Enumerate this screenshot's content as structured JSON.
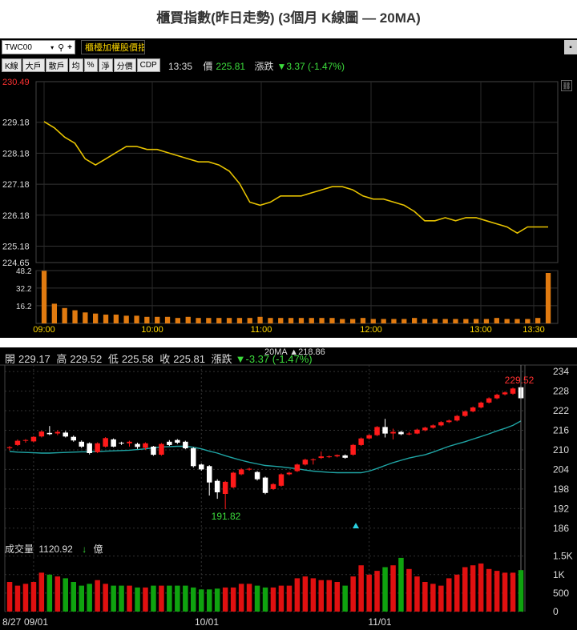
{
  "page_title": "櫃買指數(昨日走勢) (3個月 K線圖 — 20MA)",
  "intraday": {
    "code": "TWC00",
    "name": "櫃檯加權股價指",
    "buttons": [
      "K線",
      "大戶",
      "散戶",
      "均",
      "%",
      "淨",
      "分價",
      "CDP"
    ],
    "time": "13:35",
    "price_label": "價",
    "price": "225.81",
    "change_label": "漲跌",
    "change": "▼3.37 (-1.47%)"
  },
  "kline": {
    "open_label": "開",
    "open": "229.17",
    "high_label": "高",
    "high": "229.52",
    "low_label": "低",
    "low": "225.58",
    "close_label": "收",
    "close": "225.81",
    "change_label": "漲跌",
    "change": "▼-3.37 (-1.47%)",
    "ma_label": "20MA",
    "ma_value": "▲218.86",
    "volume_label": "成交量",
    "volume": "1120.92",
    "volume_arrow": "↓",
    "volume_unit": "億",
    "high_marker": "229.52",
    "low_marker": "191.82"
  },
  "chart_data": [
    {
      "type": "line",
      "name": "intraday",
      "x_ticks": [
        "09:00",
        "10:00",
        "11:00",
        "12:00",
        "13:00",
        "13:30"
      ],
      "y_ticks": [
        "230.49",
        "229.18",
        "228.18",
        "227.18",
        "226.18",
        "225.18",
        "224.65"
      ],
      "ylim": [
        224.65,
        230.49
      ],
      "color": "#e6c200",
      "values": [
        229.2,
        229.0,
        228.7,
        228.5,
        228.0,
        227.8,
        228.0,
        228.2,
        228.4,
        228.4,
        228.3,
        228.3,
        228.2,
        228.1,
        228.0,
        227.9,
        227.9,
        227.8,
        227.6,
        227.2,
        226.6,
        226.5,
        226.6,
        226.8,
        226.8,
        226.8,
        226.9,
        227.0,
        227.1,
        227.1,
        227.0,
        226.8,
        226.7,
        226.7,
        226.6,
        226.5,
        226.3,
        226.0,
        226.0,
        226.1,
        226.0,
        226.1,
        226.1,
        226.0,
        225.9,
        225.8,
        225.6,
        225.8,
        225.8,
        225.8
      ],
      "volume_ticks": [
        "48.2",
        "32.2",
        "16.2"
      ],
      "volume_max": 48.2,
      "volume": [
        48,
        18,
        14,
        12,
        10,
        9,
        8,
        8,
        7,
        7,
        6,
        6,
        6,
        5,
        6,
        5,
        5,
        5,
        5,
        5,
        5,
        6,
        5,
        5,
        5,
        5,
        5,
        5,
        5,
        4,
        4,
        5,
        4,
        4,
        4,
        4,
        5,
        4,
        4,
        4,
        4,
        4,
        4,
        4,
        5,
        4,
        4,
        4,
        5,
        46
      ]
    },
    {
      "type": "candlestick",
      "name": "3-month K line with 20MA",
      "x_ticks": [
        "8/27",
        "09/01",
        "10/01",
        "11/01"
      ],
      "y_ticks": [
        "234",
        "228",
        "222",
        "216",
        "210",
        "204",
        "198",
        "192",
        "186"
      ],
      "ylim": [
        183,
        236
      ],
      "candles": [
        [
          210.5,
          210.8,
          209.8,
          211.2
        ],
        [
          211.5,
          212.8,
          211.2,
          213.2
        ],
        [
          212.8,
          213.0,
          212.2,
          213.3
        ],
        [
          212.6,
          214.0,
          212.3,
          214.2
        ],
        [
          214.1,
          215.6,
          213.8,
          215.9
        ],
        [
          215.2,
          214.8,
          214.5,
          217.3
        ],
        [
          215.0,
          215.5,
          214.5,
          216.0
        ],
        [
          215.3,
          214.1,
          213.8,
          215.8
        ],
        [
          214.0,
          212.9,
          212.5,
          214.4
        ],
        [
          212.5,
          211.0,
          210.6,
          212.9
        ],
        [
          212.0,
          209.0,
          208.6,
          212.3
        ],
        [
          209.3,
          212.0,
          209.0,
          212.3
        ],
        [
          211.0,
          213.6,
          210.7,
          213.9
        ],
        [
          213.2,
          211.0,
          210.8,
          213.5
        ],
        [
          212.2,
          212.0,
          211.5,
          212.5
        ],
        [
          212.0,
          212.5,
          211.0,
          212.8
        ],
        [
          211.8,
          210.9,
          210.3,
          212.2
        ],
        [
          210.6,
          212.0,
          210.0,
          212.3
        ],
        [
          211.0,
          208.5,
          208.2,
          211.2
        ],
        [
          208.5,
          211.8,
          208.2,
          212.1
        ],
        [
          212.5,
          211.5,
          211.2,
          213.0
        ],
        [
          213.0,
          212.2,
          211.8,
          213.3
        ],
        [
          212.5,
          210.5,
          210.2,
          212.8
        ],
        [
          210.5,
          205.0,
          204.6,
          210.8
        ],
        [
          205.5,
          204.0,
          203.6,
          205.8
        ],
        [
          205.0,
          200.0,
          196.0,
          205.3
        ],
        [
          200.5,
          197.0,
          195.0,
          201.0
        ],
        [
          196.5,
          200.2,
          191.8,
          200.5
        ],
        [
          198.5,
          203.0,
          198.2,
          203.3
        ],
        [
          202.5,
          204.0,
          202.2,
          204.4
        ],
        [
          204.0,
          204.2,
          203.6,
          204.5
        ],
        [
          203.2,
          201.0,
          200.6,
          203.5
        ],
        [
          201.5,
          196.8,
          196.4,
          201.8
        ],
        [
          198.0,
          199.5,
          197.7,
          199.8
        ],
        [
          199.0,
          202.5,
          198.7,
          202.8
        ],
        [
          202.5,
          203.0,
          202.2,
          203.3
        ],
        [
          203.5,
          205.5,
          203.2,
          205.8
        ],
        [
          205.5,
          207.0,
          205.2,
          207.3
        ],
        [
          207.0,
          207.1,
          205.5,
          207.4
        ],
        [
          207.5,
          208.0,
          207.2,
          209.5
        ],
        [
          208.0,
          208.0,
          207.5,
          208.3
        ],
        [
          208.0,
          208.4,
          207.7,
          208.6
        ],
        [
          208.3,
          207.6,
          207.3,
          208.6
        ],
        [
          208.5,
          211.5,
          208.2,
          211.8
        ],
        [
          211.5,
          213.5,
          211.2,
          213.8
        ],
        [
          213.5,
          214.5,
          213.2,
          214.8
        ],
        [
          214.5,
          217.0,
          214.2,
          217.3
        ],
        [
          217.0,
          215.0,
          213.8,
          219.5
        ],
        [
          215.0,
          215.5,
          213.2,
          216.5
        ],
        [
          215.5,
          214.8,
          214.5,
          215.8
        ],
        [
          215.0,
          215.0,
          214.5,
          215.5
        ],
        [
          215.0,
          216.2,
          214.8,
          216.5
        ],
        [
          216.0,
          216.8,
          215.7,
          217.1
        ],
        [
          216.8,
          217.5,
          216.5,
          217.8
        ],
        [
          217.5,
          218.5,
          217.2,
          218.8
        ],
        [
          218.5,
          219.0,
          218.2,
          219.3
        ],
        [
          219.0,
          220.4,
          218.7,
          220.7
        ],
        [
          220.4,
          221.8,
          220.1,
          222.1
        ],
        [
          221.8,
          223.0,
          221.5,
          223.3
        ],
        [
          223.0,
          224.5,
          222.7,
          224.8
        ],
        [
          224.5,
          225.8,
          224.2,
          226.1
        ],
        [
          225.8,
          226.9,
          225.5,
          227.2
        ],
        [
          227.0,
          227.6,
          226.7,
          227.9
        ],
        [
          227.2,
          228.8,
          226.9,
          229.1
        ],
        [
          229.17,
          225.81,
          225.58,
          229.52
        ]
      ],
      "ma20": [
        209.5,
        209.3,
        209.2,
        209.1,
        209.0,
        209.0,
        209.1,
        209.2,
        209.3,
        209.4,
        209.4,
        209.5,
        209.6,
        209.7,
        209.8,
        209.9,
        210.1,
        210.3,
        210.6,
        210.9,
        211.0,
        211.1,
        211.1,
        210.8,
        210.3,
        209.6,
        209.0,
        208.2,
        207.5,
        206.8,
        206.2,
        205.7,
        205.2,
        205.0,
        204.8,
        204.5,
        204.2,
        203.8,
        203.5,
        203.3,
        203.1,
        203.0,
        203.0,
        203.0,
        203.0,
        203.5,
        204.3,
        205.2,
        206.1,
        206.8,
        207.5,
        208.0,
        208.5,
        209.3,
        210.2,
        211.1,
        211.8,
        212.5,
        213.3,
        214.1,
        214.9,
        215.8,
        216.6,
        217.5,
        218.86
      ],
      "ma_color": "#1fa5a5",
      "up_color": "#ff1a1a",
      "down_color": "#ffffff",
      "volume_ticks": [
        "1.5K",
        "1K",
        "500",
        "0"
      ],
      "volume_max": 1600,
      "volume": [
        800,
        700,
        750,
        800,
        1050,
        1000,
        950,
        900,
        800,
        700,
        750,
        850,
        750,
        700,
        700,
        700,
        650,
        650,
        700,
        700,
        700,
        700,
        700,
        650,
        600,
        600,
        620,
        650,
        650,
        750,
        750,
        700,
        650,
        650,
        700,
        700,
        900,
        950,
        900,
        850,
        850,
        800,
        700,
        950,
        1250,
        1000,
        1100,
        1200,
        1250,
        1450,
        1150,
        950,
        800,
        750,
        700,
        900,
        1000,
        1200,
        1250,
        1300,
        1150,
        1100,
        1050,
        1050,
        1120
      ]
    }
  ]
}
